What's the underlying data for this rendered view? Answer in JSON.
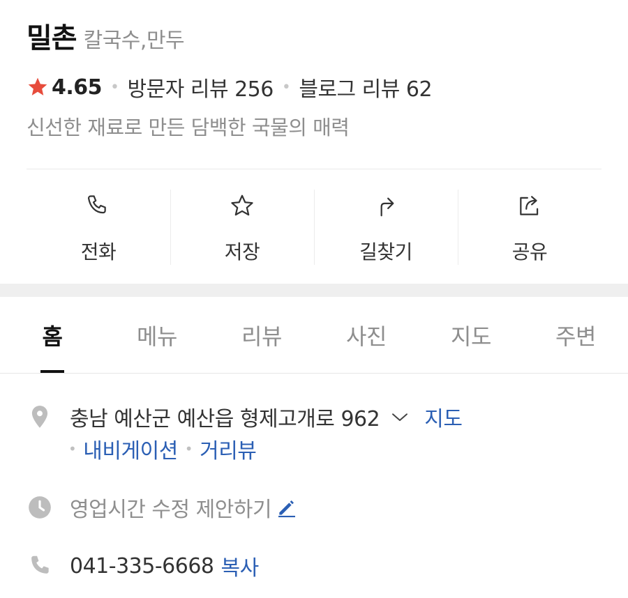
{
  "place": {
    "name": "밀촌",
    "category": "칼국수,만두",
    "rating": "4.65",
    "visitor_reviews": "방문자 리뷰 256",
    "blog_reviews": "블로그 리뷰 62",
    "description": "신선한 재료로 만든 담백한 국물의 매력"
  },
  "actions": [
    {
      "label": "전화",
      "icon": "phone-icon"
    },
    {
      "label": "저장",
      "icon": "star-outline-icon"
    },
    {
      "label": "길찾기",
      "icon": "directions-icon"
    },
    {
      "label": "공유",
      "icon": "share-icon"
    }
  ],
  "tabs": [
    {
      "label": "홈",
      "active": true
    },
    {
      "label": "메뉴"
    },
    {
      "label": "리뷰"
    },
    {
      "label": "사진"
    },
    {
      "label": "지도"
    },
    {
      "label": "주변"
    }
  ],
  "info": {
    "address": "충남 예산군 예산읍 형제고개로 962",
    "map_link": "지도",
    "navigation_link": "내비게이션",
    "street_view_link": "거리뷰",
    "hours_suggest": "영업시간 수정 제안하기",
    "phone": "041-335-6668",
    "copy_label": "복사"
  },
  "colors": {
    "star": "#e74c3c",
    "link": "#2b5fb4",
    "icon_gray": "#bdbdbd"
  }
}
